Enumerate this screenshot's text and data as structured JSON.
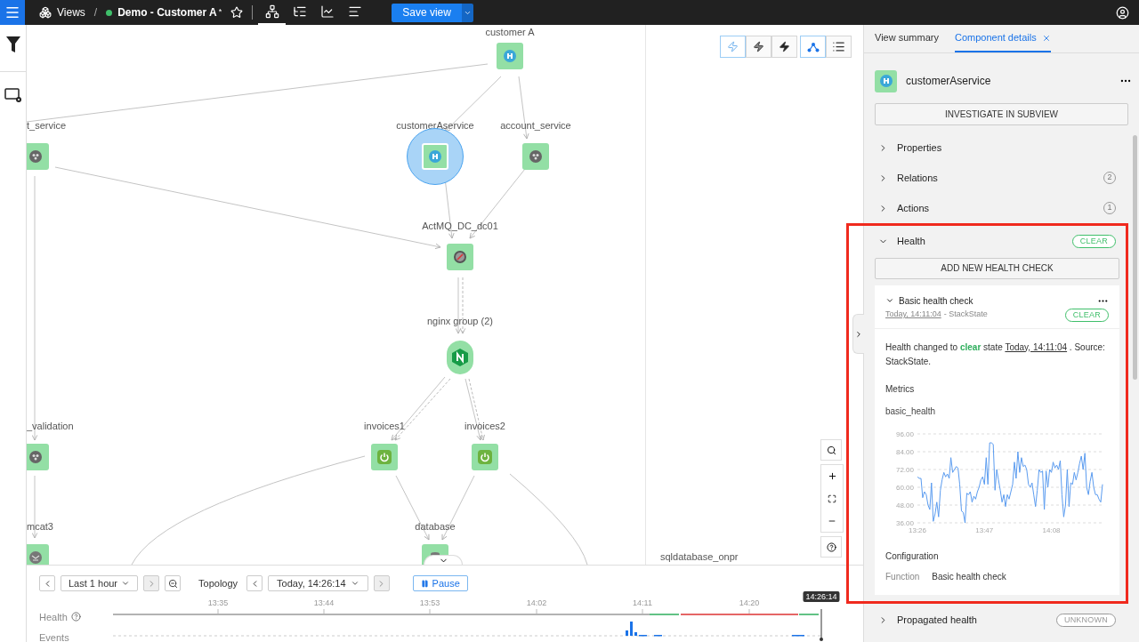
{
  "topbar": {
    "breadcrumb": "Views",
    "separator": "/",
    "view_name": "Demo - Customer A",
    "modified_mark": "*",
    "starred": false,
    "view_modes": [
      {
        "kind": "topology",
        "selected": true
      },
      {
        "kind": "list",
        "selected": false
      },
      {
        "kind": "chart",
        "selected": false
      },
      {
        "kind": "events",
        "selected": false
      }
    ],
    "save_button": "Save view"
  },
  "canvas": {
    "toolbar": [
      {
        "kind": "bolt-outline",
        "selected": true
      },
      {
        "kind": "bolt-half",
        "selected": false
      },
      {
        "kind": "bolt-solid",
        "selected": false
      },
      {
        "kind": "graph",
        "selected": true
      },
      {
        "kind": "list",
        "selected": false
      }
    ],
    "nodes": [
      {
        "label": "customer A",
        "kind": "person",
        "selected": false
      },
      {
        "label": "t_service",
        "kind": "service",
        "selected": false
      },
      {
        "label": "customerAservice",
        "kind": "person",
        "selected": true
      },
      {
        "label": "account_service",
        "kind": "service",
        "selected": false
      },
      {
        "label": "ActMQ_DC_dc01",
        "kind": "queue",
        "selected": false
      },
      {
        "label": "nginx group (2)",
        "kind": "nginx",
        "selected": false
      },
      {
        "label": "_validation",
        "kind": "service",
        "selected": false
      },
      {
        "label": "invoices1",
        "kind": "spring",
        "selected": false
      },
      {
        "label": "invoices2",
        "kind": "spring",
        "selected": false
      },
      {
        "label": "mcat3",
        "kind": "tomcat",
        "selected": false
      },
      {
        "label": "database",
        "kind": "db",
        "selected": false
      }
    ],
    "labels": [
      "sqldatabase_onpr"
    ]
  },
  "timeline": {
    "range": "Last 1 hour",
    "mode": "Topology",
    "time": "Today, 14:26:14",
    "pause": "Pause",
    "rows": [
      "Health",
      "Events"
    ],
    "ticks": [
      "13:35",
      "13:44",
      "13:53",
      "14:02",
      "14:11",
      "14:20"
    ],
    "current": "14:26:14"
  },
  "panel": {
    "tabs": [
      {
        "label": "View summary",
        "selected": false
      },
      {
        "label": "Component details",
        "selected": true
      }
    ],
    "component": "customerAservice",
    "investigate": "INVESTIGATE IN SUBVIEW",
    "sections": [
      {
        "label": "Properties",
        "expanded": false
      },
      {
        "label": "Relations",
        "count": "2",
        "expanded": false
      },
      {
        "label": "Actions",
        "count": "1",
        "expanded": false
      }
    ],
    "health": {
      "label": "Health",
      "expanded": true,
      "color": "#3fbf6a",
      "badge": "CLEAR",
      "add_button": "ADD NEW HEALTH CHECK",
      "check": {
        "title": "Basic health check",
        "expanded": true,
        "time": "Today, 14:11:04",
        "source": "- StackState",
        "color": "#3fbf6a",
        "badge": "CLEAR",
        "message": {
          "prefix": "Health changed to",
          "state": "clear",
          "middle": "state",
          "time": "Today, 14:11:04",
          "suffix": ". Source:",
          "source": "StackState."
        },
        "metrics_label": "Metrics",
        "chart_data": {
          "type": "line",
          "grid": true,
          "ylim": [
            36,
            96
          ],
          "categories": [
            "13:26",
            null,
            null,
            null,
            null,
            null,
            null,
            null,
            null,
            null,
            null,
            null,
            null,
            null,
            null,
            null,
            null,
            null,
            null,
            null,
            null,
            null,
            null,
            null,
            null,
            null,
            null,
            null,
            null,
            null,
            null,
            null,
            null,
            null,
            null,
            null,
            null,
            null,
            "13:47",
            null,
            null,
            null,
            null,
            null,
            null,
            null,
            null,
            null,
            null,
            null,
            null,
            null,
            null,
            null,
            null,
            null,
            null,
            null,
            null,
            null,
            null,
            null,
            null,
            null,
            null,
            null,
            null,
            null,
            null,
            null,
            null,
            null,
            null,
            null,
            null,
            null,
            "14:08",
            null,
            null,
            null,
            null,
            null,
            null,
            null,
            null,
            null,
            null,
            null,
            null,
            null,
            null,
            null,
            null,
            null,
            null,
            null,
            null,
            null,
            null,
            null,
            null,
            null,
            null,
            null,
            null,
            null
          ],
          "yticks": [
            {
              "value": 36,
              "label": "36.00"
            },
            {
              "value": 48,
              "label": "48.00"
            },
            {
              "value": 60,
              "label": "60.00"
            },
            {
              "value": 72,
              "label": "72.00"
            },
            {
              "value": 84,
              "label": "84.00"
            },
            {
              "value": 96,
              "label": "96.00"
            }
          ],
          "series": [
            {
              "name": "basic_health",
              "color": "#5b9cf0",
              "values": [
                67,
                66,
                66,
                53,
                57,
                55,
                48,
                45,
                63,
                37,
                42,
                50,
                40,
                58,
                65,
                70,
                67,
                69,
                66,
                80,
                70,
                72,
                74,
                73,
                62,
                44,
                43,
                36,
                56,
                55,
                57,
                50,
                54,
                52,
                57,
                60,
                65,
                67,
                62,
                80,
                62,
                90,
                90,
                89,
                58,
                72,
                65,
                58,
                50,
                55,
                47,
                55,
                52,
                57,
                62,
                77,
                66,
                84,
                70,
                80,
                74,
                75,
                72,
                62,
                60,
                63,
                55,
                47,
                58,
                72,
                70,
                71,
                45,
                71,
                60,
                72,
                70,
                77,
                73,
                75,
                72,
                78,
                55,
                40,
                48,
                72,
                47,
                63,
                62,
                70,
                65,
                70,
                76,
                81,
                72,
                83,
                60,
                55,
                64,
                70,
                60,
                55,
                55,
                52,
                50,
                62
              ]
            }
          ]
        },
        "config_label": "Configuration",
        "config": [
          {
            "key": "Function",
            "value": "Basic health check"
          }
        ]
      }
    },
    "propagated": {
      "label": "Propagated health",
      "expanded": false,
      "color": "#999999",
      "badge": "UNKNOWN"
    }
  }
}
